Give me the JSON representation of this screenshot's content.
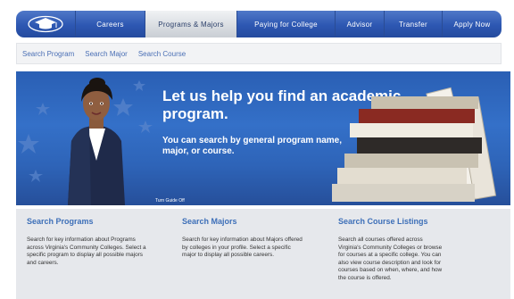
{
  "nav": {
    "logo_icon": "graduation-cap-icon",
    "items": [
      {
        "label": "Careers"
      },
      {
        "label": "Programs & Majors"
      },
      {
        "label": "Paying for College"
      },
      {
        "label": "Advisor"
      },
      {
        "label": "Transfer"
      },
      {
        "label": "Apply Now"
      }
    ]
  },
  "subnav": {
    "items": [
      {
        "label": "Search Program"
      },
      {
        "label": "Search Major"
      },
      {
        "label": "Search Course"
      }
    ]
  },
  "hero": {
    "title": "Let us help you find an academic program.",
    "subtitle": "You can search by general program name, major,  or course.",
    "turn_guide": "Turn Guide Off"
  },
  "columns": [
    {
      "title": "Search Programs",
      "text": "Search for key information about Programs across Virginia's Community Colleges. Select a specific program to display all possible majors and careers."
    },
    {
      "title": "Search Majors",
      "text": "Search for key information about Majors offered by colleges in your profile. Select a specific major to display all possible careers."
    },
    {
      "title": "Search Course Listings",
      "text": "Search all courses offered across Virginia's Community Colleges or browse for courses at a specific college. You can also view course description and look for courses based on when, where, and how the course is offered."
    }
  ],
  "colors": {
    "nav_blue": "#2d57b2",
    "link_blue": "#4a6fb5",
    "heading_blue": "#3d6fb8"
  }
}
